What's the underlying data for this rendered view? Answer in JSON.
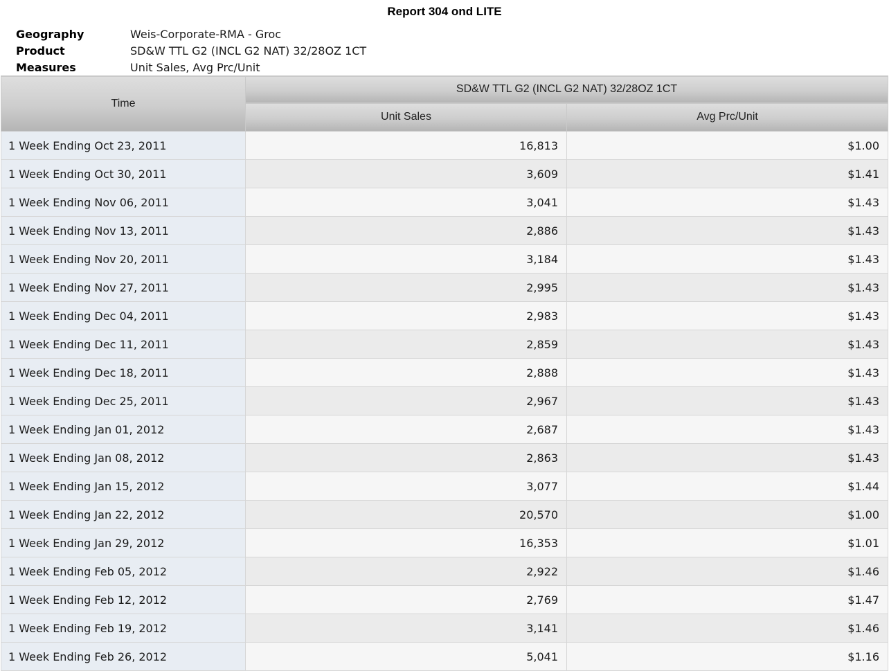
{
  "report": {
    "title": "Report 304 ond LITE"
  },
  "meta": [
    {
      "key": "Geography",
      "value": "Weis-Corporate-RMA - Groc"
    },
    {
      "key": "Product",
      "value": "SD&W TTL G2 (INCL G2 NAT) 32/28OZ 1CT"
    },
    {
      "key": "Measures",
      "value": "Unit Sales, Avg Prc/Unit"
    }
  ],
  "table": {
    "time_header": "Time",
    "group_header": "SD&W TTL G2 (INCL G2 NAT) 32/28OZ 1CT",
    "measure_headers": [
      "Unit Sales",
      "Avg Prc/Unit"
    ],
    "rows": [
      {
        "time": "1 Week Ending Oct 23, 2011",
        "units": "16,813",
        "price": "$1.00"
      },
      {
        "time": "1 Week Ending Oct 30, 2011",
        "units": "3,609",
        "price": "$1.41"
      },
      {
        "time": "1 Week Ending Nov 06, 2011",
        "units": "3,041",
        "price": "$1.43"
      },
      {
        "time": "1 Week Ending Nov 13, 2011",
        "units": "2,886",
        "price": "$1.43"
      },
      {
        "time": "1 Week Ending Nov 20, 2011",
        "units": "3,184",
        "price": "$1.43"
      },
      {
        "time": "1 Week Ending Nov 27, 2011",
        "units": "2,995",
        "price": "$1.43"
      },
      {
        "time": "1 Week Ending Dec 04, 2011",
        "units": "2,983",
        "price": "$1.43"
      },
      {
        "time": "1 Week Ending Dec 11, 2011",
        "units": "2,859",
        "price": "$1.43"
      },
      {
        "time": "1 Week Ending Dec 18, 2011",
        "units": "2,888",
        "price": "$1.43"
      },
      {
        "time": "1 Week Ending Dec 25, 2011",
        "units": "2,967",
        "price": "$1.43"
      },
      {
        "time": "1 Week Ending Jan 01, 2012",
        "units": "2,687",
        "price": "$1.43"
      },
      {
        "time": "1 Week Ending Jan 08, 2012",
        "units": "2,863",
        "price": "$1.43"
      },
      {
        "time": "1 Week Ending Jan 15, 2012",
        "units": "3,077",
        "price": "$1.44"
      },
      {
        "time": "1 Week Ending Jan 22, 2012",
        "units": "20,570",
        "price": "$1.00"
      },
      {
        "time": "1 Week Ending Jan 29, 2012",
        "units": "16,353",
        "price": "$1.01"
      },
      {
        "time": "1 Week Ending Feb 05, 2012",
        "units": "2,922",
        "price": "$1.46"
      },
      {
        "time": "1 Week Ending Feb 12, 2012",
        "units": "2,769",
        "price": "$1.47"
      },
      {
        "time": "1 Week Ending Feb 19, 2012",
        "units": "3,141",
        "price": "$1.46"
      },
      {
        "time": "1 Week Ending Feb 26, 2012",
        "units": "5,041",
        "price": "$1.16"
      }
    ]
  }
}
